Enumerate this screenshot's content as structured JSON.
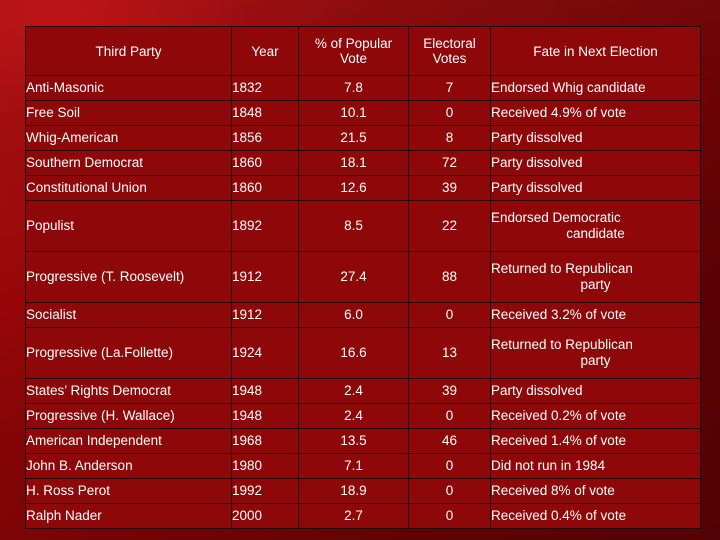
{
  "table": {
    "columns": [
      {
        "key": "party",
        "label": "Third Party"
      },
      {
        "key": "year",
        "label": "Year"
      },
      {
        "key": "popular",
        "label": "% of Popular Vote"
      },
      {
        "key": "electoral",
        "label": "Electoral Votes"
      },
      {
        "key": "fate",
        "label": "Fate in Next Election"
      }
    ],
    "header": {
      "party": "Third Party",
      "year": "Year",
      "popular_line1": "% of Popular",
      "popular_line2": "Vote",
      "electoral_line1": "Electoral",
      "electoral_line2": "Votes",
      "fate": "Fate in Next Election"
    },
    "rows": [
      {
        "party": "Anti-Masonic",
        "year": "1832",
        "popular": "7.8",
        "electoral": "7",
        "fate": "Endorsed Whig candidate",
        "fate_line2": "",
        "tall": false
      },
      {
        "party": "Free Soil",
        "year": "1848",
        "popular": "10.1",
        "electoral": "0",
        "fate": "Received 4.9% of vote",
        "fate_line2": "",
        "tall": false
      },
      {
        "party": "Whig-American",
        "year": "1856",
        "popular": "21.5",
        "electoral": "8",
        "fate": "Party dissolved",
        "fate_line2": "",
        "tall": false
      },
      {
        "party": "Southern Democrat",
        "year": "1860",
        "popular": "18.1",
        "electoral": "72",
        "fate": "Party dissolved",
        "fate_line2": "",
        "tall": false
      },
      {
        "party": "Constitutional Union",
        "year": "1860",
        "popular": "12.6",
        "electoral": "39",
        "fate": "Party dissolved",
        "fate_line2": "",
        "tall": false
      },
      {
        "party": "Populist",
        "year": "1892",
        "popular": "8.5",
        "electoral": "22",
        "fate": "Endorsed Democratic",
        "fate_line2": "candidate",
        "tall": true
      },
      {
        "party": "Progressive (T. Roosevelt)",
        "year": "1912",
        "popular": "27.4",
        "electoral": "88",
        "fate": "Returned to Republican",
        "fate_line2": "party",
        "tall": true
      },
      {
        "party": "Socialist",
        "year": "1912",
        "popular": "6.0",
        "electoral": "0",
        "fate": "Received 3.2% of vote",
        "fate_line2": "",
        "tall": false
      },
      {
        "party": "Progressive (La.Follette)",
        "year": "1924",
        "popular": "16.6",
        "electoral": "13",
        "fate": "Returned to Republican",
        "fate_line2": "party",
        "tall": true
      },
      {
        "party": "States’ Rights Democrat",
        "year": "1948",
        "popular": "2.4",
        "electoral": "39",
        "fate": "Party dissolved",
        "fate_line2": "",
        "tall": false
      },
      {
        "party": "Progressive (H. Wallace)",
        "year": "1948",
        "popular": "2.4",
        "electoral": "0",
        "fate": "Received 0.2% of vote",
        "fate_line2": "",
        "tall": false
      },
      {
        "party": "American Independent",
        "year": "1968",
        "popular": "13.5",
        "electoral": "46",
        "fate": "Received 1.4% of vote",
        "fate_line2": "",
        "tall": false
      },
      {
        "party": "John B. Anderson",
        "year": "1980",
        "popular": "7.1",
        "electoral": "0",
        "fate": "Did not run in 1984",
        "fate_line2": "",
        "tall": false
      },
      {
        "party": "H. Ross Perot",
        "year": "1992",
        "popular": "18.9",
        "electoral": "0",
        "fate": "Received 8% of vote",
        "fate_line2": "",
        "tall": false
      },
      {
        "party": "Ralph Nader",
        "year": "2000",
        "popular": "2.7",
        "electoral": "0",
        "fate": "Received 0.4% of vote",
        "fate_line2": "",
        "tall": false
      }
    ]
  },
  "colors": {
    "background_red": "#8d0006",
    "cell_fill": "#8e0709",
    "border": "#200000",
    "text": "#ffffff"
  }
}
